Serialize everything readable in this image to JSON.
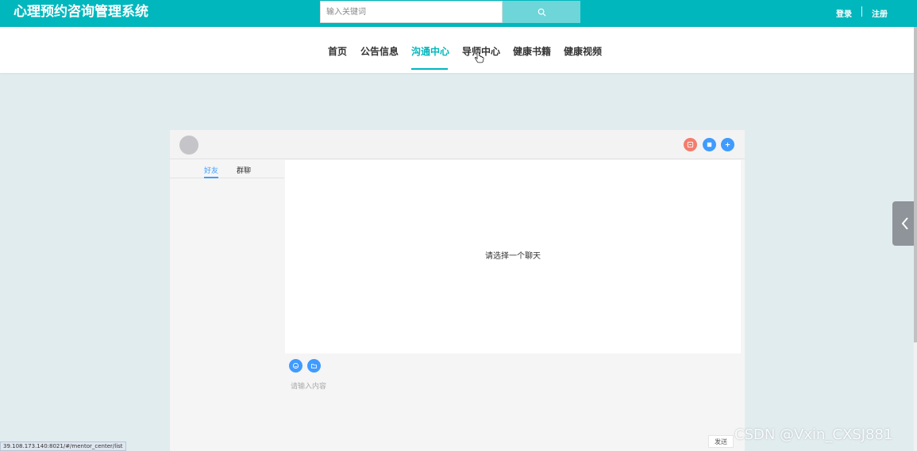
{
  "header": {
    "app_title": "心理预约咨询管理系统",
    "search_placeholder": "输入关键词",
    "login_label": "登录",
    "register_label": "注册"
  },
  "nav": {
    "items": [
      "首页",
      "公告信息",
      "沟通中心",
      "导师中心",
      "健康书籍",
      "健康视频"
    ],
    "active": "沟通中心"
  },
  "chat": {
    "tabs": [
      "好友",
      "群聊"
    ],
    "active_tab": "好友",
    "empty_text": "请选择一个聊天",
    "input_placeholder": "请输入内容",
    "send_label": "发送"
  },
  "status_bar": {
    "url": "39.108.173.140:8021/#/mentor_center/list"
  },
  "watermark": "CSDN @Vxin_CXSJ881",
  "colors": {
    "accent": "#00b7bd",
    "blue": "#3f9bff",
    "red": "#f47c6c"
  },
  "icons": [
    "search-icon",
    "chevron-left-icon",
    "hand-cursor-icon",
    "emoji-icon",
    "folder-icon",
    "exit-icon",
    "menu-icon",
    "plus-icon"
  ]
}
